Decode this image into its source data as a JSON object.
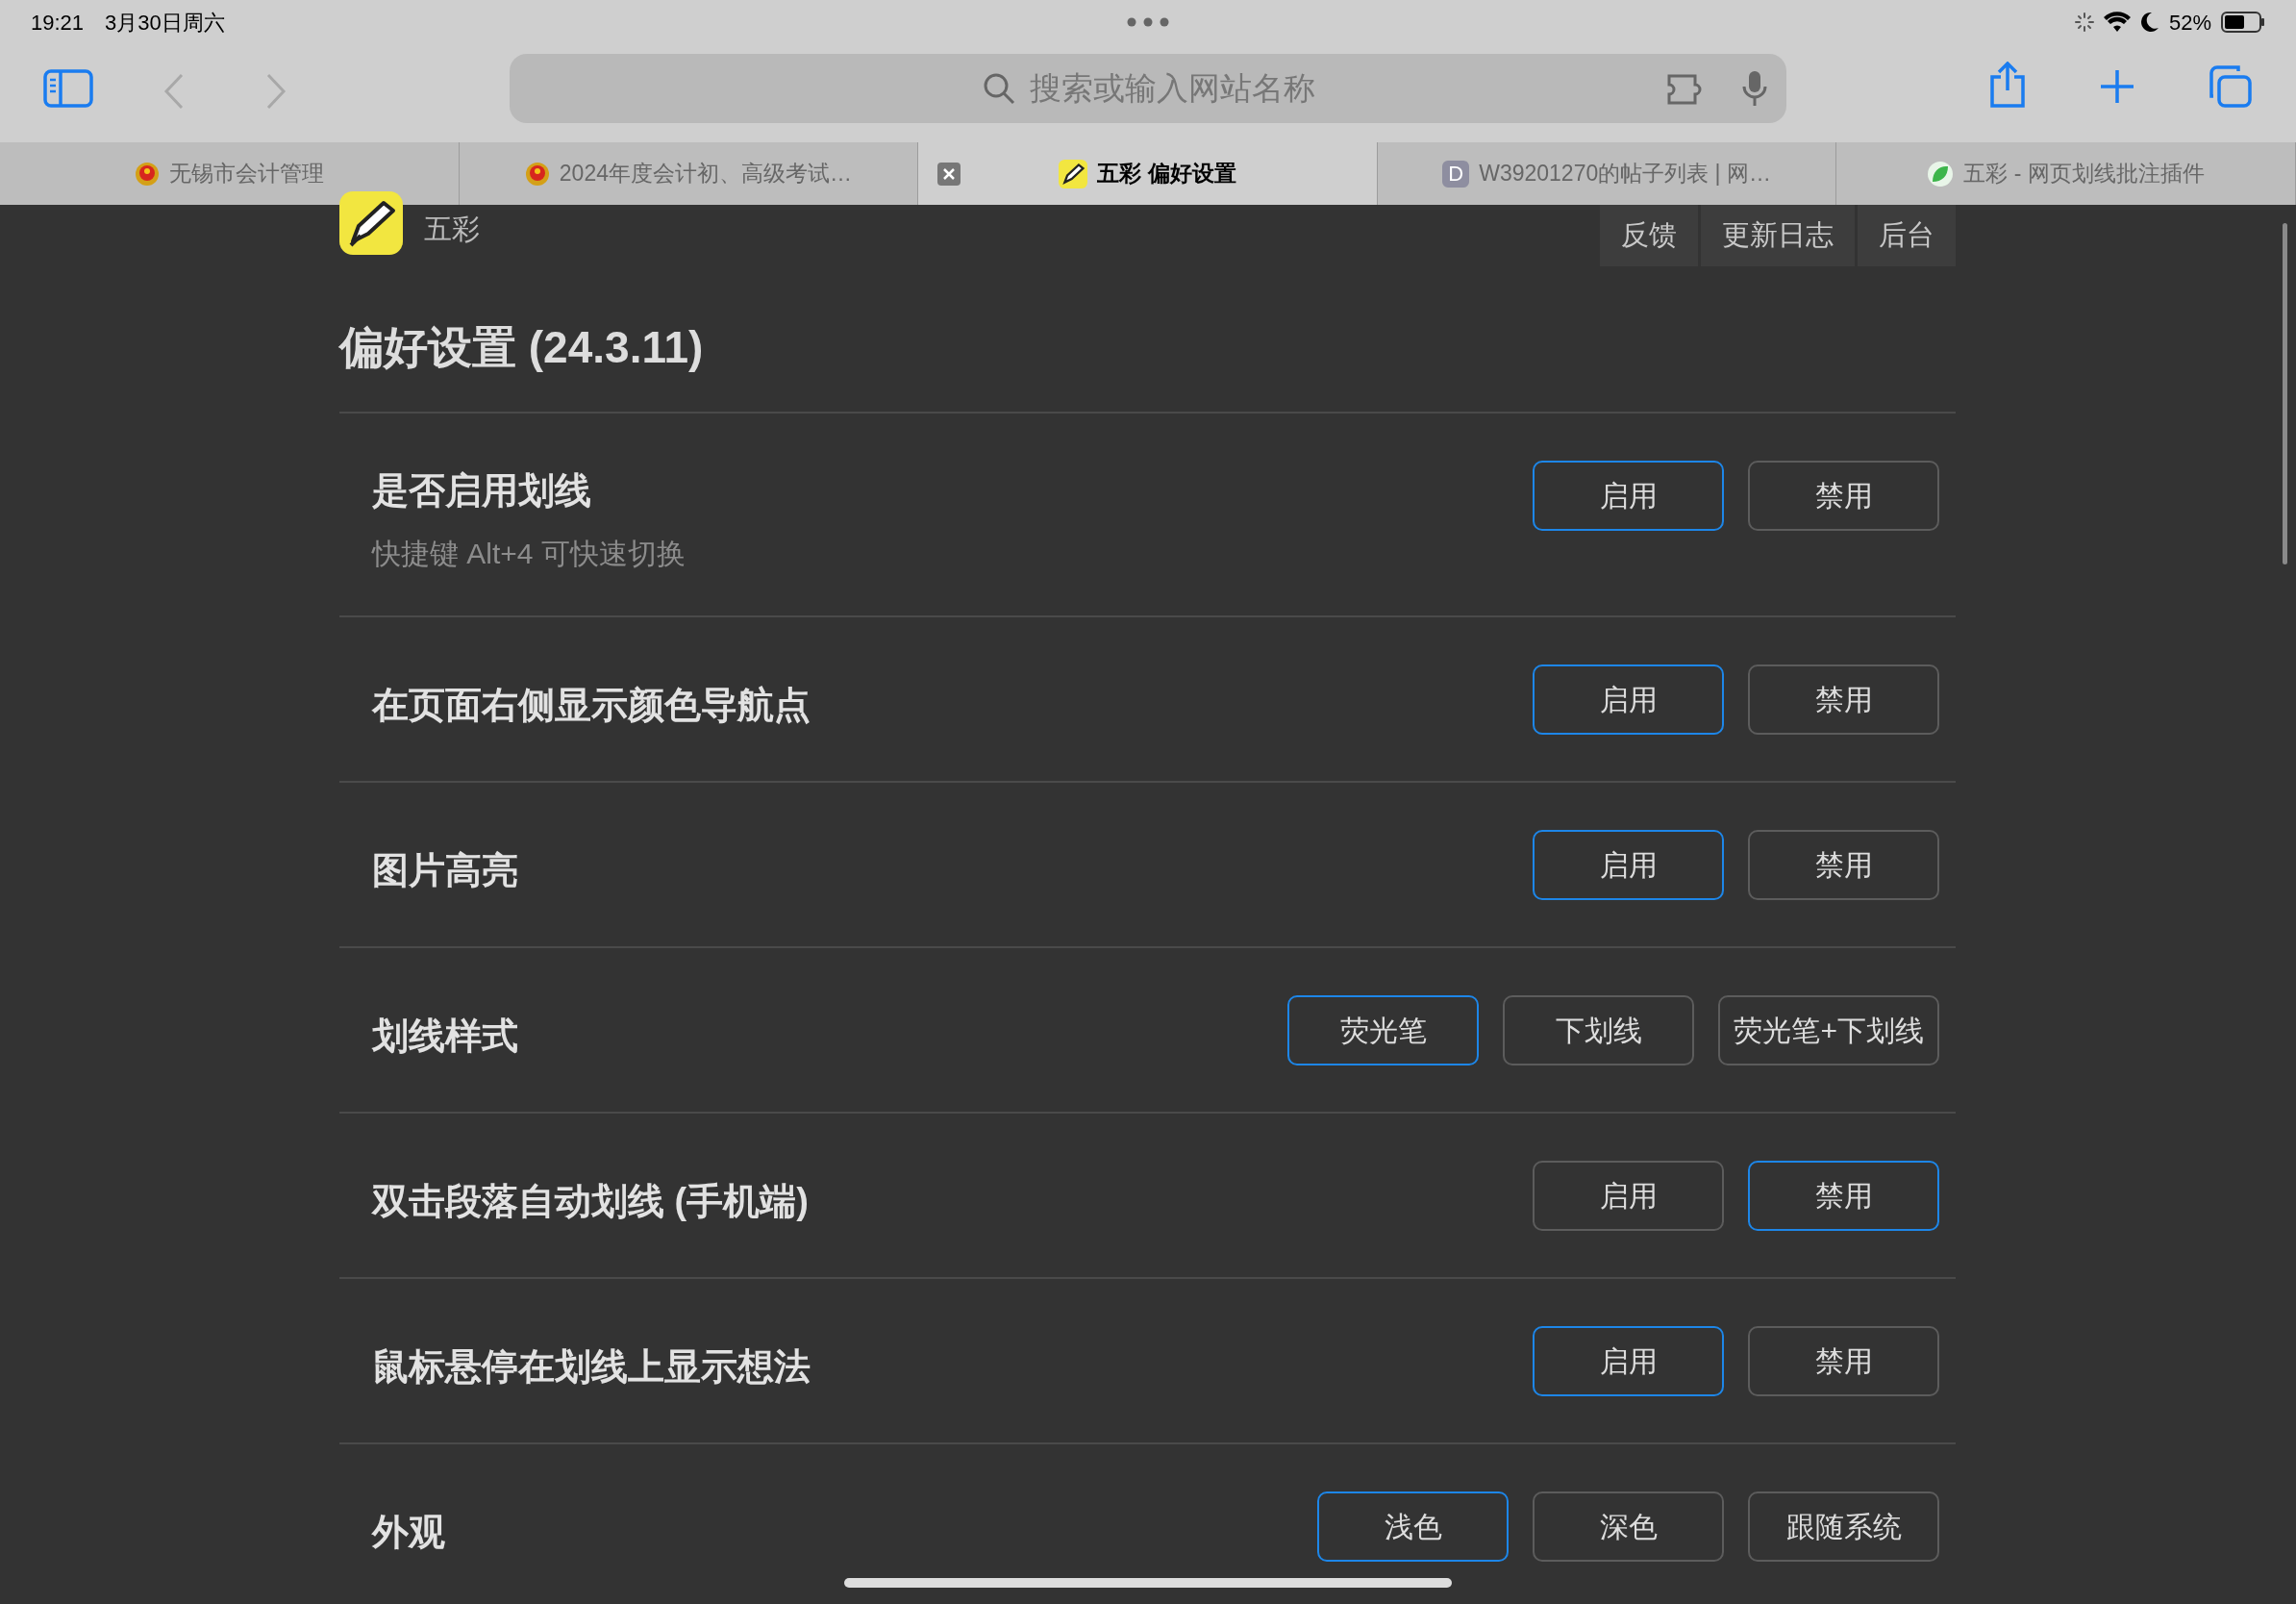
{
  "status_bar": {
    "time": "19:21",
    "date": "3月30日周六",
    "battery": "52%"
  },
  "toolbar": {
    "search_placeholder": "搜索或输入网站名称"
  },
  "tabs": [
    {
      "title": "无锡市会计管理",
      "kind": "emblem",
      "selected": false
    },
    {
      "title": "2024年度会计初、高级考试…",
      "kind": "emblem",
      "selected": false
    },
    {
      "title": "五彩 偏好设置",
      "kind": "pen",
      "selected": true
    },
    {
      "title": "W39201270的帖子列表 | 网…",
      "kind": "letter",
      "favicon_text": "D",
      "selected": false
    },
    {
      "title": "五彩 - 网页划线批注插件",
      "kind": "leaf",
      "selected": false
    }
  ],
  "page": {
    "brand": "五彩",
    "nav": [
      "反馈",
      "更新日志",
      "后台"
    ],
    "heading": "偏好设置 (24.3.11)",
    "settings": [
      {
        "title": "是否启用划线",
        "subtitle": "快捷键 Alt+4 可快速切换",
        "options": [
          {
            "label": "启用",
            "selected": true
          },
          {
            "label": "禁用",
            "selected": false
          }
        ]
      },
      {
        "title": "在页面右侧显示颜色导航点",
        "options": [
          {
            "label": "启用",
            "selected": true
          },
          {
            "label": "禁用",
            "selected": false
          }
        ]
      },
      {
        "title": "图片高亮",
        "options": [
          {
            "label": "启用",
            "selected": true
          },
          {
            "label": "禁用",
            "selected": false
          }
        ]
      },
      {
        "title": "划线样式",
        "options": [
          {
            "label": "荧光笔",
            "selected": true
          },
          {
            "label": "下划线",
            "selected": false
          },
          {
            "label": "荧光笔+下划线",
            "selected": false
          }
        ]
      },
      {
        "title": "双击段落自动划线 (手机端)",
        "options": [
          {
            "label": "启用",
            "selected": false
          },
          {
            "label": "禁用",
            "selected": true
          }
        ]
      },
      {
        "title": "鼠标悬停在划线上显示想法",
        "options": [
          {
            "label": "启用",
            "selected": true
          },
          {
            "label": "禁用",
            "selected": false
          }
        ]
      },
      {
        "title": "外观",
        "options": [
          {
            "label": "浅色",
            "selected": true
          },
          {
            "label": "深色",
            "selected": false
          },
          {
            "label": "跟随系统",
            "selected": false
          }
        ]
      }
    ]
  }
}
